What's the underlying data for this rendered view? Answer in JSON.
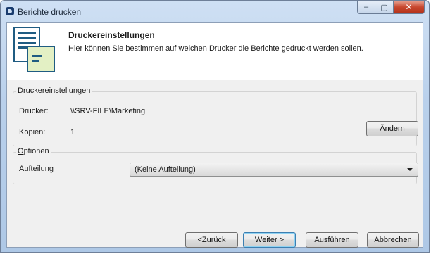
{
  "window": {
    "title": "Berichte drucken",
    "controls": [
      "–",
      "▢",
      "✕"
    ]
  },
  "header": {
    "title": "Druckereinstellungen",
    "subtitle": "Hier können Sie bestimmen auf welchen Drucker die Berichte gedruckt werden sollen.",
    "icon": "document-print-icon"
  },
  "printer_group": {
    "title_first": "D",
    "title_rest": "ruckereinstellungen",
    "printer_label": "Drucker:",
    "printer_value": "\\\\SRV-FILE\\Marketing",
    "copies_label": "Kopien:",
    "copies_value": "1",
    "change_button_pre": "Ä",
    "change_button_u": "n",
    "change_button_post": "dern"
  },
  "options_group": {
    "title_first": "O",
    "title_rest": "ptionen",
    "split_label_pre": "Auf",
    "split_label_u": "t",
    "split_label_post": "eilung",
    "split_value": "(Keine Aufteilung)"
  },
  "footer": {
    "back_pre": "< ",
    "back_u": "Z",
    "back_post": "urück",
    "next_u": "W",
    "next_post": "eiter >",
    "run_pre": "A",
    "run_u": "u",
    "run_post": "sführen",
    "cancel_u": "A",
    "cancel_post": "bbrechen"
  },
  "colors": {
    "accent": "#3c7fb1",
    "close_button": "#c8482f",
    "icon_blue": "#1f5c82",
    "icon_green": "#e3f0c4"
  }
}
